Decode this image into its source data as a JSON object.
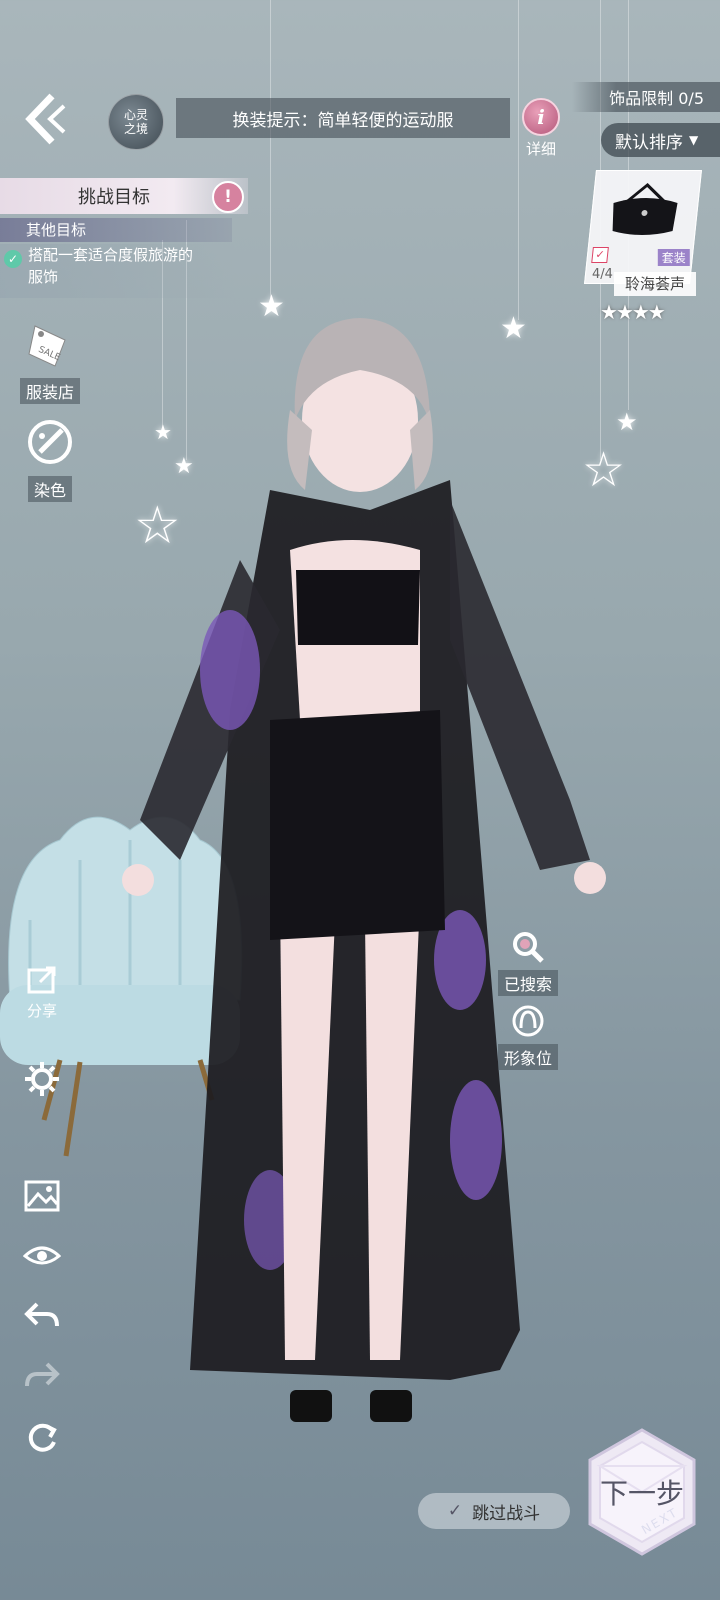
{
  "header": {
    "spirit_badge": "心灵\n之境",
    "hint": "换装提示：简单轻便的运动服",
    "detail_label": "详细",
    "limit": "饰品限制 0/5",
    "sort_label": "默认排序"
  },
  "challenge": {
    "title": "挑战目标",
    "other_goal": "其他目标",
    "goal_text_line1": "搭配一套适合度假旅游的",
    "goal_text_line2": "服饰"
  },
  "side_tools": {
    "shop": "服装店",
    "dye": "染色",
    "share": "分享"
  },
  "item_card": {
    "count": "4/4",
    "tag": "套装",
    "name": "聆海荟声",
    "rating": 4
  },
  "right_actions": {
    "searched": "已搜索",
    "image_slot": "形象位"
  },
  "bottom": {
    "next_label": "下一步",
    "next_sub": "NEXT",
    "skip_label": "跳过战斗"
  },
  "icons": [
    "back-icon",
    "info-icon",
    "sale-tag-icon",
    "palette-icon",
    "share-icon",
    "settings-icon",
    "image-icon",
    "eye-icon",
    "undo-icon",
    "redo-icon",
    "reset-icon",
    "search-icon",
    "portrait-icon",
    "check-icon"
  ]
}
